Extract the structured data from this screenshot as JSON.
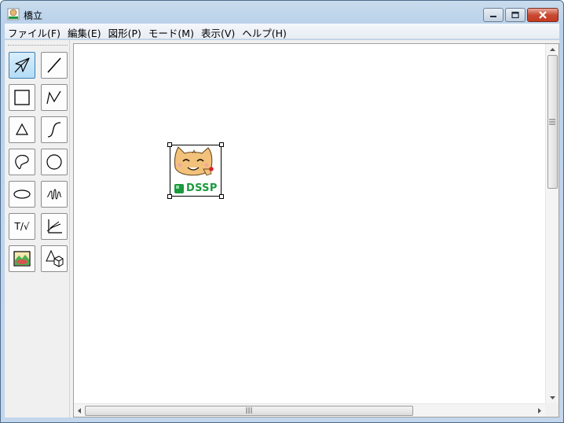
{
  "window": {
    "title": "橋立",
    "icon": "app-icon"
  },
  "caption_buttons": [
    {
      "name": "minimize-button",
      "icon": "minimize-icon"
    },
    {
      "name": "maximize-button",
      "icon": "maximize-icon"
    },
    {
      "name": "close-button",
      "icon": "close-icon"
    }
  ],
  "menu": [
    {
      "label": "ファイル(F)"
    },
    {
      "label": "編集(E)"
    },
    {
      "label": "図形(P)"
    },
    {
      "label": "モード(M)"
    },
    {
      "label": "表示(V)"
    },
    {
      "label": "ヘルプ(H)"
    }
  ],
  "toolbox": {
    "selected_tool": "select-tool",
    "tools": [
      {
        "name": "select-tool",
        "icon": "arrow-pointer-icon"
      },
      {
        "name": "line-tool",
        "icon": "line-icon"
      },
      {
        "name": "rectangle-tool",
        "icon": "square-icon"
      },
      {
        "name": "polyline-tool",
        "icon": "polyline-icon"
      },
      {
        "name": "triangle-tool",
        "icon": "triangle-icon"
      },
      {
        "name": "curve-tool",
        "icon": "s-curve-icon"
      },
      {
        "name": "freeform-tool",
        "icon": "freeform-closed-icon"
      },
      {
        "name": "circle-tool",
        "icon": "circle-icon"
      },
      {
        "name": "ellipse-tool",
        "icon": "ellipse-icon"
      },
      {
        "name": "scribble-tool",
        "icon": "scribble-icon"
      },
      {
        "name": "text-formula-tool",
        "label": "T/√"
      },
      {
        "name": "graph-tool",
        "icon": "axes-graph-icon"
      },
      {
        "name": "image-tool",
        "icon": "picture-icon"
      },
      {
        "name": "solid-shapes-tool",
        "icon": "shapes-3d-icon"
      }
    ]
  },
  "canvas": {
    "objects": [
      {
        "name": "image-object",
        "icon": "cat-mascot-icon",
        "badge_text": "DSSP",
        "selected": true
      }
    ]
  },
  "colors": {
    "selection_blue": "#3c7fb1",
    "badge_green": "#1a9a3c",
    "close_red": "#c84a33"
  }
}
